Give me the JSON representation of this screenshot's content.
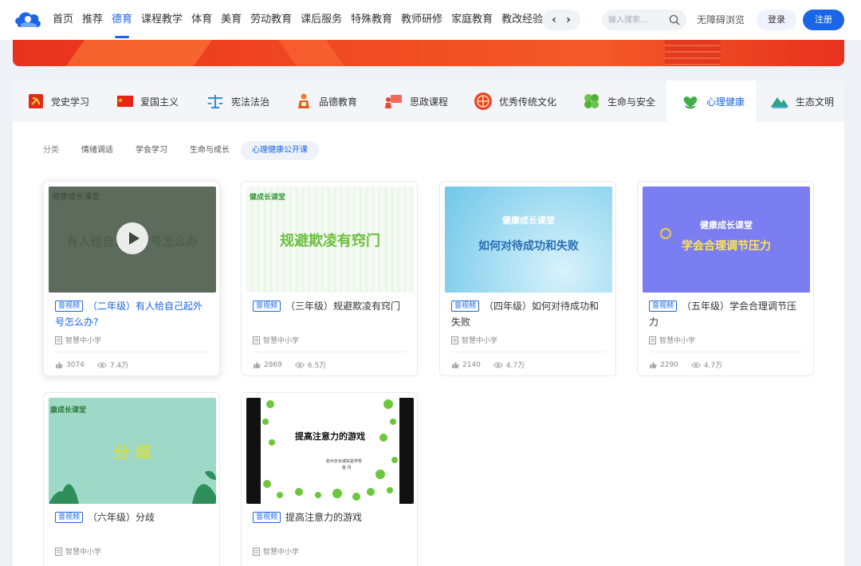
{
  "nav": {
    "items": [
      "首页",
      "推荐",
      "德育",
      "课程教学",
      "体育",
      "美育",
      "劳动教育",
      "课后服务",
      "特殊教育",
      "教师研修",
      "家庭教育",
      "教改经验"
    ],
    "active_index": 2,
    "prev_arrow": "‹",
    "next_arrow": "›",
    "search_placeholder": "输入搜索...",
    "accessible": "无障碍浏览",
    "login": "登录",
    "register": "注册"
  },
  "categories": {
    "items": [
      {
        "label": "党史学习",
        "icon": "party-emblem-icon"
      },
      {
        "label": "爱国主义",
        "icon": "flag-icon"
      },
      {
        "label": "宪法法治",
        "icon": "scales-icon"
      },
      {
        "label": "品德教育",
        "icon": "person-book-icon"
      },
      {
        "label": "思政课程",
        "icon": "lecture-icon"
      },
      {
        "label": "优秀传统文化",
        "icon": "pattern-medallion-icon"
      },
      {
        "label": "生命与安全",
        "icon": "clover-icon"
      },
      {
        "label": "心理健康",
        "icon": "heart-leaf-icon"
      },
      {
        "label": "生态文明",
        "icon": "mountain-icon"
      }
    ],
    "active_index": 7
  },
  "subtabs": {
    "label": "分类",
    "items": [
      "情绪调适",
      "学会学习",
      "生命与成长",
      "心理健康公开课"
    ],
    "active_index": 3
  },
  "cards": [
    {
      "badge": "音视频",
      "title": "（二年级）有人给自己起外号怎么办?",
      "source": "智慧中小学",
      "likes": "3074",
      "views": "7.4万",
      "thumb_text": "有人给自己起外号怎么办",
      "thumb_header": "健康成长课堂"
    },
    {
      "badge": "音视频",
      "title": "（三年级）规避欺凌有窍门",
      "source": "智慧中小学",
      "likes": "2869",
      "views": "6.5万",
      "thumb_text": "规避欺凌有窍门",
      "thumb_header": "健成长课堂"
    },
    {
      "badge": "音视频",
      "title": "（四年级）如何对待成功和失败",
      "source": "智慧中小学",
      "likes": "2140",
      "views": "4.7万",
      "thumb_text": "如何对待成功和失败",
      "thumb_header": "健康成长课堂"
    },
    {
      "badge": "音视频",
      "title": "（五年级）学会合理调节压力",
      "source": "智慧中小学",
      "likes": "2290",
      "views": "4.7万",
      "thumb_text": "学会合理调节压力",
      "thumb_header": "健康成长课堂"
    },
    {
      "badge": "音视频",
      "title": "（六年级）分歧",
      "source": "智慧中小学",
      "thumb_text": "分 歧",
      "thumb_header": "康成长课堂"
    },
    {
      "badge": "音视频",
      "title": "提高注意力的游戏",
      "source": "智慧中小学",
      "thumb_text": "提高注意力的游戏",
      "thumb_sub1": "杭州天长城实验学校",
      "thumb_sub2": "金 丹"
    }
  ]
}
